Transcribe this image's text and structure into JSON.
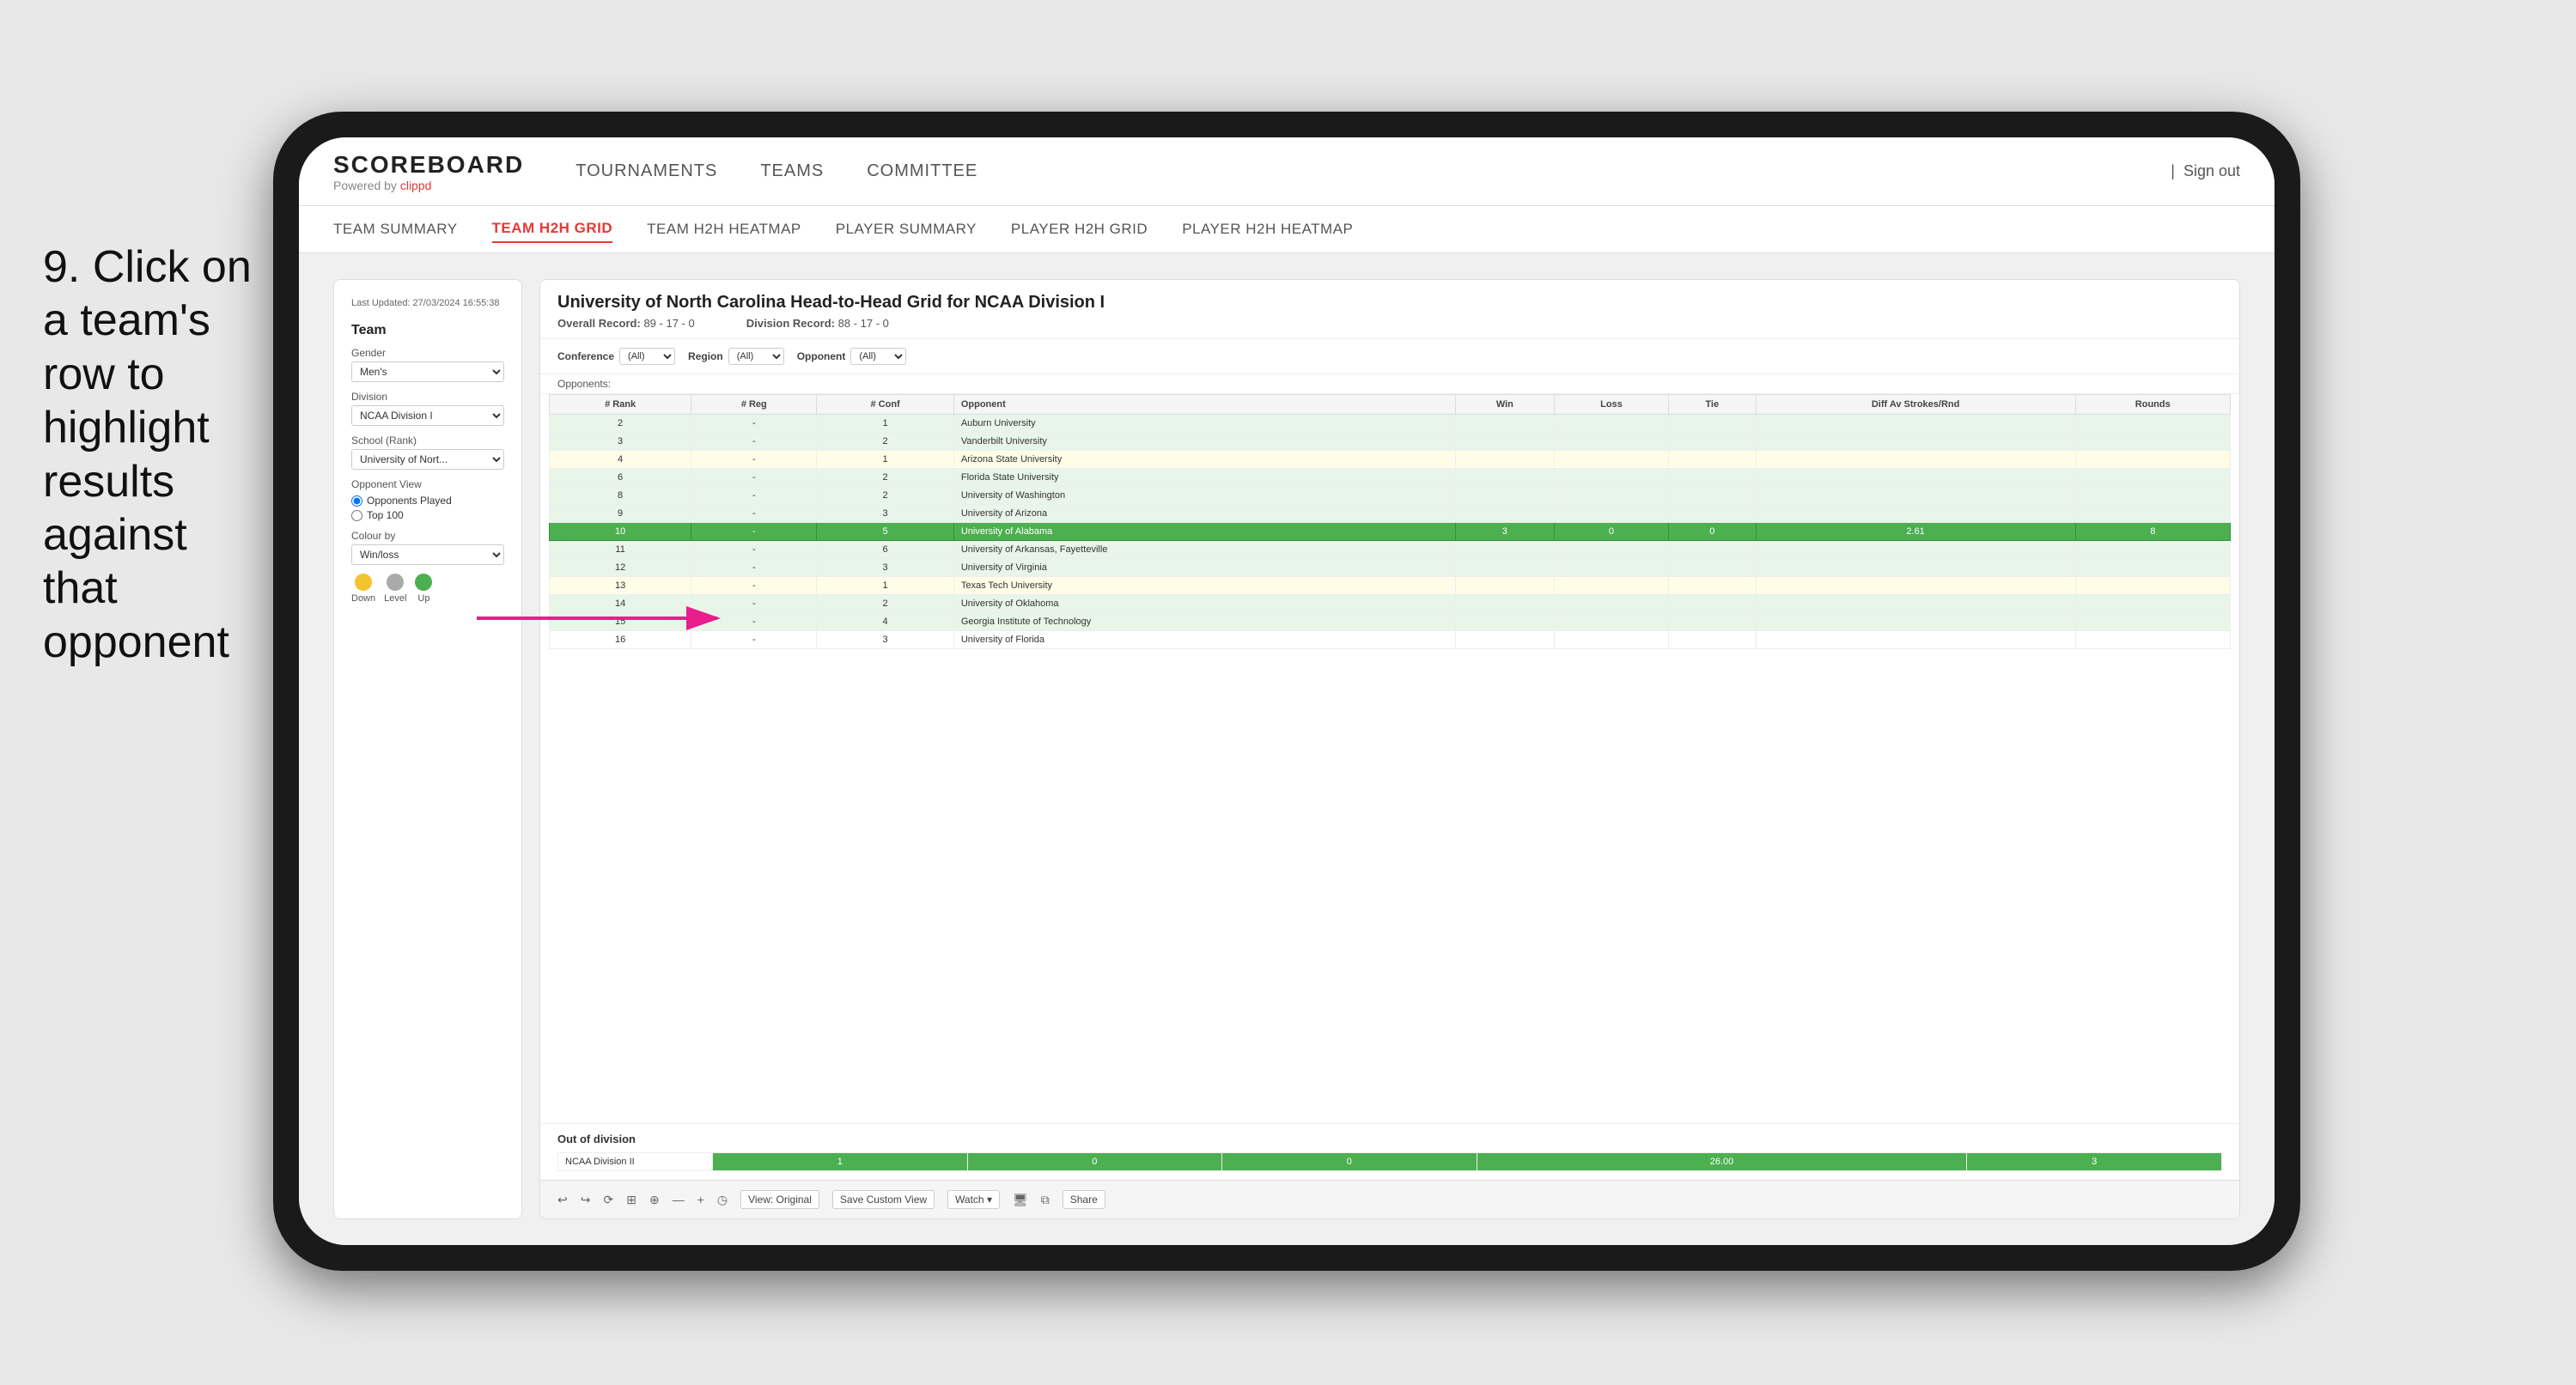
{
  "instruction": {
    "text": "9. Click on a team's row to highlight results against that opponent"
  },
  "nav": {
    "logo": "SCOREBOARD",
    "logo_sub": "Powered by clippd",
    "items": [
      "TOURNAMENTS",
      "TEAMS",
      "COMMITTEE"
    ],
    "sign_out_sep": "|",
    "sign_out": "Sign out"
  },
  "sub_nav": {
    "items": [
      "TEAM SUMMARY",
      "TEAM H2H GRID",
      "TEAM H2H HEATMAP",
      "PLAYER SUMMARY",
      "PLAYER H2H GRID",
      "PLAYER H2H HEATMAP"
    ],
    "active_index": 1
  },
  "sidebar": {
    "last_updated": "Last Updated: 27/03/2024\n16:55:38",
    "team_label": "Team",
    "gender_label": "Gender",
    "gender_value": "Men's",
    "division_label": "Division",
    "division_value": "NCAA Division I",
    "school_rank_label": "School (Rank)",
    "school_rank_value": "University of Nort...",
    "opponent_view_label": "Opponent View",
    "opponent_view_options": [
      "Opponents Played",
      "Top 100"
    ],
    "opponent_view_selected": "Opponents Played",
    "colour_by_label": "Colour by",
    "colour_by_value": "Win/loss",
    "legend": {
      "down_label": "Down",
      "level_label": "Level",
      "up_label": "Up",
      "down_color": "#f4c430",
      "level_color": "#aaa",
      "up_color": "#4caf50"
    }
  },
  "main_panel": {
    "title": "University of North Carolina Head-to-Head Grid for NCAA Division I",
    "overall_record_label": "Overall Record:",
    "overall_record": "89 - 17 - 0",
    "division_record_label": "Division Record:",
    "division_record": "88 - 17 - 0",
    "filters": {
      "conference_label": "Conference",
      "conference_value": "(All)",
      "region_label": "Region",
      "region_value": "(All)",
      "opponent_label": "Opponent",
      "opponent_value": "(All)"
    },
    "opponents_label": "Opponents:",
    "table_headers": [
      "# Rank",
      "# Reg",
      "# Conf",
      "Opponent",
      "Win",
      "Loss",
      "Tie",
      "Diff Av Strokes/Rnd",
      "Rounds"
    ],
    "rows": [
      {
        "rank": "2",
        "reg": "-",
        "conf": "1",
        "opponent": "Auburn University",
        "win": "",
        "loss": "",
        "tie": "",
        "diff": "",
        "rounds": "",
        "style": "light-green"
      },
      {
        "rank": "3",
        "reg": "-",
        "conf": "2",
        "opponent": "Vanderbilt University",
        "win": "",
        "loss": "",
        "tie": "",
        "diff": "",
        "rounds": "",
        "style": "light-green"
      },
      {
        "rank": "4",
        "reg": "-",
        "conf": "1",
        "opponent": "Arizona State University",
        "win": "",
        "loss": "",
        "tie": "",
        "diff": "",
        "rounds": "",
        "style": "light-yellow"
      },
      {
        "rank": "6",
        "reg": "-",
        "conf": "2",
        "opponent": "Florida State University",
        "win": "",
        "loss": "",
        "tie": "",
        "diff": "",
        "rounds": "",
        "style": "light-green"
      },
      {
        "rank": "8",
        "reg": "-",
        "conf": "2",
        "opponent": "University of Washington",
        "win": "",
        "loss": "",
        "tie": "",
        "diff": "",
        "rounds": "",
        "style": "light-green"
      },
      {
        "rank": "9",
        "reg": "-",
        "conf": "3",
        "opponent": "University of Arizona",
        "win": "",
        "loss": "",
        "tie": "",
        "diff": "",
        "rounds": "",
        "style": "light-green"
      },
      {
        "rank": "10",
        "reg": "-",
        "conf": "5",
        "opponent": "University of Alabama",
        "win": "3",
        "loss": "0",
        "tie": "0",
        "diff": "2.61",
        "rounds": "8",
        "style": "highlighted"
      },
      {
        "rank": "11",
        "reg": "-",
        "conf": "6",
        "opponent": "University of Arkansas, Fayetteville",
        "win": "",
        "loss": "",
        "tie": "",
        "diff": "",
        "rounds": "",
        "style": "light-green"
      },
      {
        "rank": "12",
        "reg": "-",
        "conf": "3",
        "opponent": "University of Virginia",
        "win": "",
        "loss": "",
        "tie": "",
        "diff": "",
        "rounds": "",
        "style": "light-green"
      },
      {
        "rank": "13",
        "reg": "-",
        "conf": "1",
        "opponent": "Texas Tech University",
        "win": "",
        "loss": "",
        "tie": "",
        "diff": "",
        "rounds": "",
        "style": "light-yellow"
      },
      {
        "rank": "14",
        "reg": "-",
        "conf": "2",
        "opponent": "University of Oklahoma",
        "win": "",
        "loss": "",
        "tie": "",
        "diff": "",
        "rounds": "",
        "style": "light-green"
      },
      {
        "rank": "15",
        "reg": "-",
        "conf": "4",
        "opponent": "Georgia Institute of Technology",
        "win": "",
        "loss": "",
        "tie": "",
        "diff": "",
        "rounds": "",
        "style": "light-green"
      },
      {
        "rank": "16",
        "reg": "-",
        "conf": "3",
        "opponent": "University of Florida",
        "win": "",
        "loss": "",
        "tie": "",
        "diff": "",
        "rounds": "",
        "style": ""
      }
    ],
    "out_of_division_title": "Out of division",
    "out_of_division_rows": [
      {
        "label": "NCAA Division II",
        "win": "1",
        "loss": "0",
        "tie": "0",
        "diff": "26.00",
        "rounds": "3"
      }
    ],
    "toolbar_buttons": [
      "◀",
      "▶",
      "⟳",
      "⊞",
      "⊕",
      "—",
      "+",
      "◷",
      "View: Original",
      "Save Custom View",
      "Watch ▾",
      "🖥",
      "⧉",
      "Share"
    ]
  }
}
